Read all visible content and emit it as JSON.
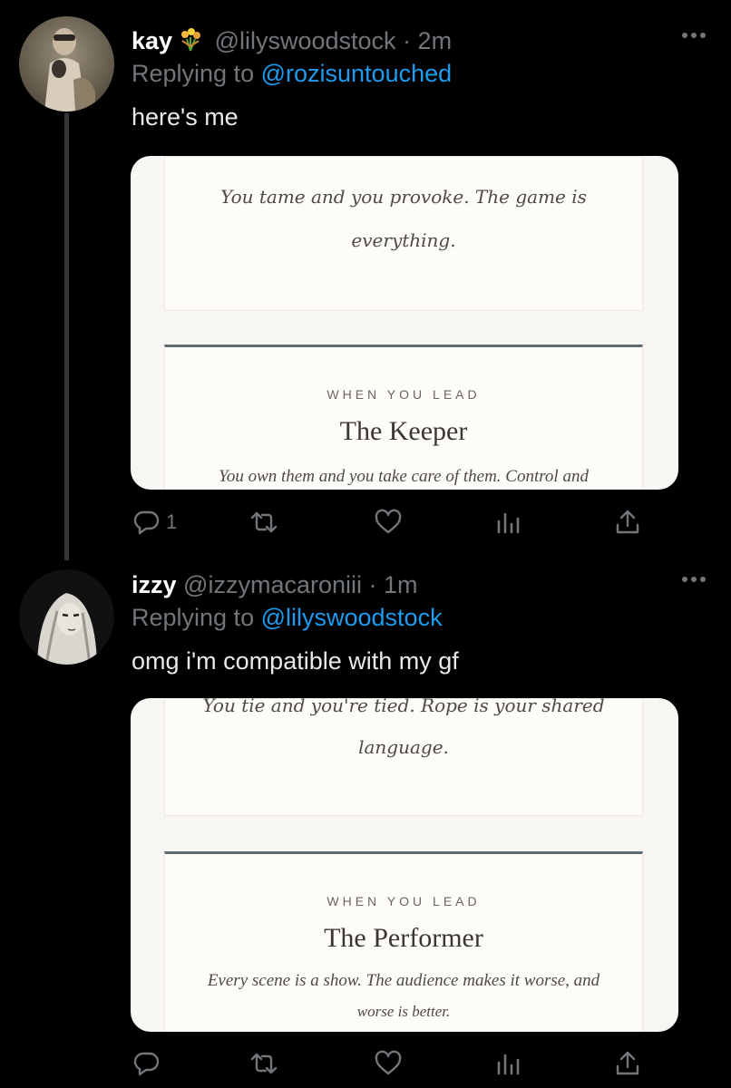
{
  "tweets": [
    {
      "name": "kay",
      "name_emoji": "💐",
      "handle": "@lilyswoodstock",
      "time": "· 2m",
      "replying_prefix": "Replying to",
      "replying_to": "@rozisuntouched",
      "text": "here's me",
      "media": {
        "quote": "You tame and you provoke. The game is everything.",
        "quote_line1": "You tame and you provoke. The game is",
        "quote_line2": "everything.",
        "eyebrow": "WHEN YOU LEAD",
        "title": "The Keeper",
        "description_line1": "You own them and you take care of them. Control and",
        "description_line2": ""
      },
      "actions": {
        "reply_count": "1",
        "retweet_count": "",
        "like_count": ""
      }
    },
    {
      "name": "izzy",
      "handle": "@izzymacaroniii",
      "time": "· 1m",
      "replying_prefix": "Replying to",
      "replying_to": "@lilyswoodstock",
      "text": "omg i'm compatible with my gf",
      "media": {
        "quote_line1": "You tie and you're tied. Rope is your shared",
        "quote_line2": "language.",
        "eyebrow": "WHEN YOU LEAD",
        "title": "The Performer",
        "description_line1": "Every scene is a show. The audience makes it worse, and",
        "description_line2": "worse is better."
      },
      "actions": {
        "reply_count": "",
        "retweet_count": "",
        "like_count": ""
      }
    }
  ],
  "icons": [
    "more-icon",
    "reply-icon",
    "retweet-icon",
    "like-icon",
    "analytics-icon",
    "share-icon"
  ],
  "colors": {
    "background": "#000000",
    "link": "#1d9bf0",
    "secondary_text": "#71767b",
    "card_background": "#fdfcf9",
    "card_rule": "#5f6c74"
  }
}
